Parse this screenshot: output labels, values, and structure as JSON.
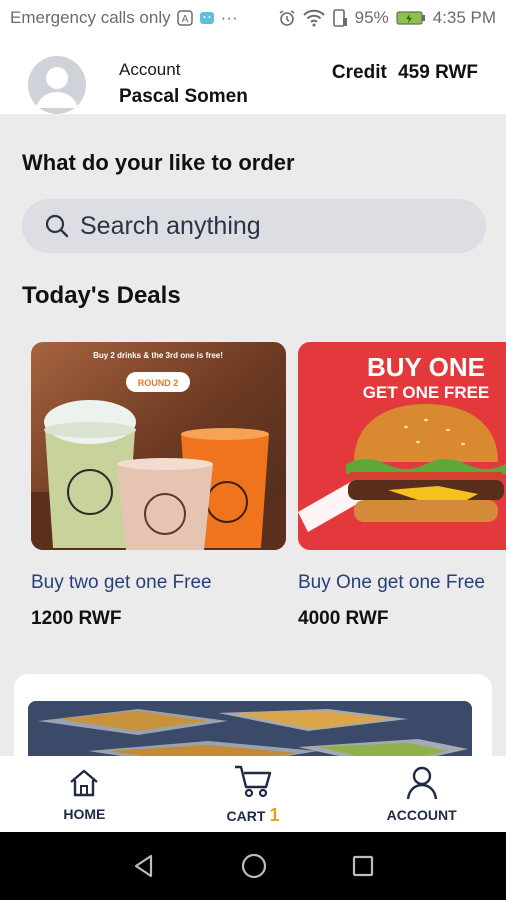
{
  "status_bar": {
    "carrier": "Emergency calls only",
    "battery": "95%",
    "time": "4:35 PM",
    "icons": [
      "wifi-icon",
      "alarm-icon",
      "battery-icon"
    ]
  },
  "header": {
    "account_label": "Account",
    "user_name": "Pascal Somen",
    "credit_label": "Credit",
    "credit_amount": "459 RWF"
  },
  "main": {
    "question": "What do your like to order",
    "search_placeholder": "Search anything",
    "deals_title": "Today's Deals",
    "deals": [
      {
        "name": "Buy two get one Free",
        "price": "1200 RWF",
        "banner_text": "Buy 2 drinks & the 3rd one is free!",
        "badge": "ROUND 2"
      },
      {
        "name": "Buy One get one Free",
        "price": "4000 RWF",
        "banner_line1": "BUY ONE",
        "banner_line2": "GET ONE FREE"
      }
    ]
  },
  "bottom_nav": {
    "home": "HOME",
    "cart": "CART",
    "cart_count": "1",
    "account": "ACCOUNT"
  },
  "colors": {
    "accent_text": "#27407a",
    "badge": "#e8a315",
    "background": "#ebebeb",
    "promo_red": "#e3393c"
  }
}
